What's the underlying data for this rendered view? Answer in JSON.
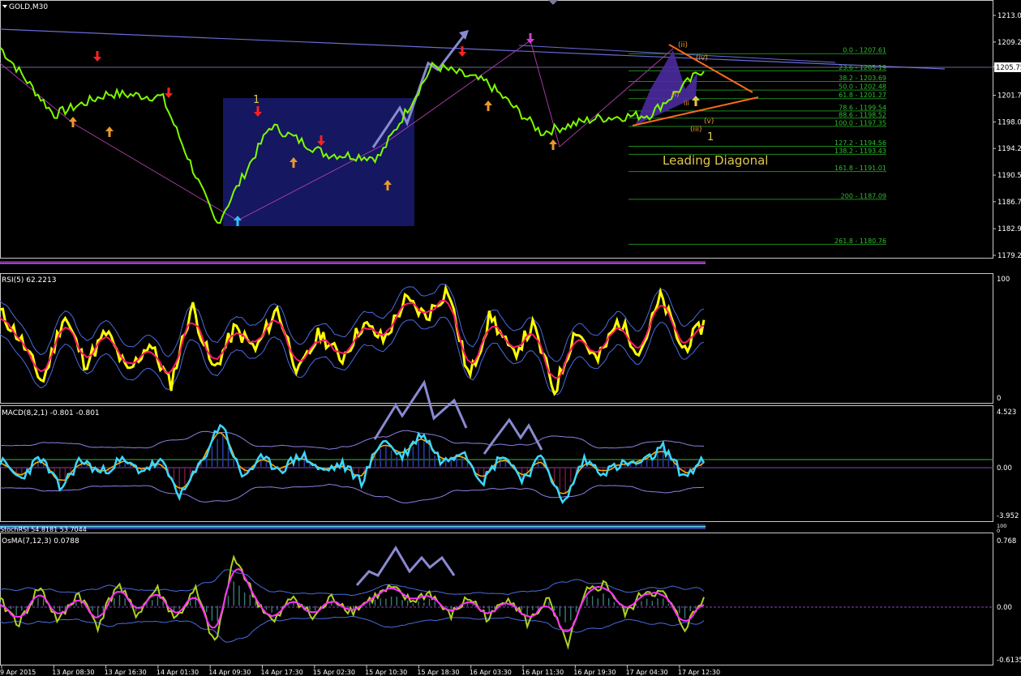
{
  "window": {
    "symbol_title": "GOLD,M30",
    "dropdown_icon": "triangle-down-icon"
  },
  "main_panel": {
    "price_ticks": [
      "1213.00",
      "1209.25",
      "1205.75",
      "1201.75",
      "1198.00",
      "1194.25",
      "1190.50",
      "1186.75",
      "1182.95",
      "1179.20"
    ],
    "current_price": "1205.75",
    "wave_labels": {
      "left_one": "1",
      "ii": "(ii)",
      "iv": "(iv)",
      "i": "(i)",
      "iii_small": "iii",
      "iii": "(iii)",
      "v": "(v)",
      "right_one": "1"
    },
    "pattern_label": "Leading Diagonal",
    "fib_levels": [
      "0.0 - 1207.61",
      "23.6 - 1205.19",
      "38.2 - 1203.69",
      "50.0 - 1202.48",
      "61.8 - 1201.27",
      "78.6 - 1199.54",
      "88.6 - 1198.52",
      "100.0 - 1197.35",
      "127.2 - 1194.56",
      "138.2 - 1193.43",
      "161.8 - 1191.01",
      "200 - 1187.09",
      "261.8 - 1180.76"
    ]
  },
  "rsi_panel": {
    "title": "RSI(5) 62.2213",
    "ticks": [
      "100",
      "0"
    ]
  },
  "macd_panel": {
    "title": "MACD(8,2,1) -0.801 -0.801",
    "ticks": [
      "4.523",
      "0.00",
      "-3.952"
    ]
  },
  "stoch_panel": {
    "title": "StochRSI 54.8181 53.7044",
    "ticks": [
      "100",
      "0"
    ]
  },
  "osma_panel": {
    "title": "OsMA(7,12,3) 0.0788",
    "ticks": [
      "0.768",
      "0.00",
      "-0.6135"
    ]
  },
  "time_axis": [
    "9 Apr 2015",
    "13 Apr 08:30",
    "13 Apr 16:30",
    "14 Apr 01:30",
    "14 Apr 09:30",
    "14 Apr 17:30",
    "15 Apr 02:30",
    "15 Apr 10:30",
    "15 Apr 18:30",
    "16 Apr 03:30",
    "16 Apr 11:30",
    "16 Apr 19:30",
    "17 Apr 04:30",
    "17 Apr 12:30"
  ],
  "chart_data": [
    {
      "type": "line",
      "title": "GOLD,M30",
      "xlabel": "",
      "ylabel": "",
      "ylim": [
        1179.2,
        1213.0
      ],
      "x": [
        "9 Apr 2015",
        "13 Apr 08:30",
        "13 Apr 16:30",
        "14 Apr 01:30",
        "14 Apr 09:30",
        "14 Apr 17:30",
        "15 Apr 02:30",
        "15 Apr 10:30",
        "15 Apr 18:30",
        "16 Apr 03:30",
        "16 Apr 11:30",
        "16 Apr 19:30",
        "17 Apr 04:30",
        "17 Apr 12:30"
      ],
      "series": [
        {
          "name": "",
          "values": [
            1208.5,
            1199.0,
            1202.0,
            1201.5,
            1183.5,
            1197.5,
            1193.5,
            1193.0,
            1206.0,
            1203.5,
            1196.5,
            1198.5,
            1199.0,
            1205.5
          ]
        }
      ],
      "colors": {
        "price": "#7cfc00",
        "fib_line": "#1f8a1f",
        "fib_text": "#2fbf2f",
        "zone": "#151760",
        "diagonal": "#ff6a1a",
        "projection": "#8a8ad0",
        "trend": "#6a6ad8"
      }
    },
    {
      "type": "line",
      "title": "RSI(5) 62.2213",
      "ylim": [
        0,
        100
      ],
      "series": [
        {
          "name": "",
          "values": [
            72,
            48,
            12,
            70,
            28,
            55,
            20,
            46,
            10,
            78,
            22,
            58,
            40,
            75,
            20,
            55,
            32,
            62,
            48,
            82,
            68,
            92,
            15,
            70,
            35,
            60,
            5,
            58,
            30,
            65,
            38,
            85,
            40,
            62
          ]
        }
      ]
    },
    {
      "type": "line",
      "title": "MACD(8,2,1) -0.801 -0.801",
      "ylim": [
        -3.952,
        4.523
      ],
      "series": [
        {
          "name": "",
          "values": [
            0.5,
            -1.0,
            0.8,
            -1.8,
            0.6,
            -0.5,
            0.5,
            -0.3,
            0.4,
            -2.4,
            0.3,
            3.7,
            -0.8,
            0.6,
            -0.2,
            1.0,
            -0.4,
            0.2,
            -1.2,
            2.3,
            0.8,
            2.8,
            0.3,
            1.5,
            -1.2,
            1.1,
            -1.0,
            0.9,
            -3.2,
            0.6,
            -0.4,
            0.2,
            0.3,
            1.6,
            -0.8,
            0.5
          ]
        }
      ]
    },
    {
      "type": "line",
      "title": "OsMA(7,12,3) 0.0788",
      "ylim": [
        -0.6135,
        0.768
      ],
      "series": [
        {
          "name": "",
          "values": [
            0.05,
            -0.2,
            0.22,
            -0.18,
            0.15,
            -0.22,
            0.25,
            -0.1,
            0.2,
            -0.15,
            0.18,
            -0.45,
            0.58,
            0.1,
            -0.2,
            0.12,
            -0.14,
            0.1,
            -0.06,
            0.08,
            0.2,
            0.05,
            0.15,
            -0.12,
            0.1,
            -0.15,
            0.12,
            -0.2,
            0.08,
            -0.45,
            0.15,
            0.25,
            -0.1,
            0.18,
            0.12,
            -0.25,
            0.08
          ]
        }
      ]
    }
  ]
}
